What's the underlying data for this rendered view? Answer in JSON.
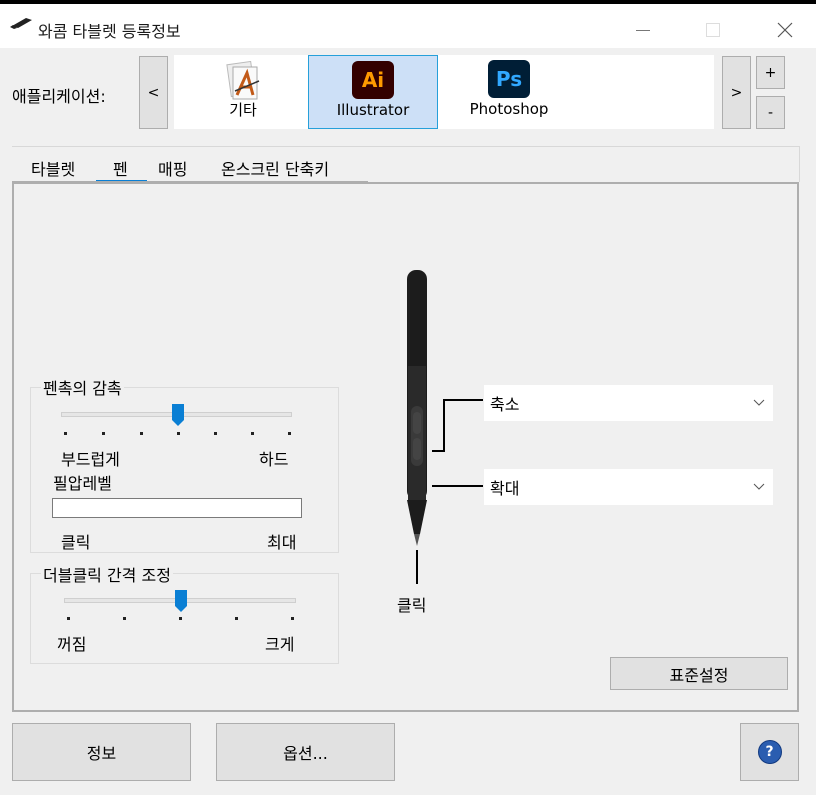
{
  "window": {
    "title": "와콤 타블렛 등록정보"
  },
  "app_bar": {
    "label": "애플리케이션:",
    "prev": "<",
    "next": ">",
    "add": "+",
    "remove": "-",
    "apps": [
      {
        "name": "기타",
        "icon": "other-apps-icon"
      },
      {
        "name": "Illustrator",
        "icon": "illustrator-icon",
        "icon_text": "Ai",
        "selected": true
      },
      {
        "name": "Photoshop",
        "icon": "photoshop-icon",
        "icon_text": "Ps"
      }
    ]
  },
  "tabs": [
    {
      "label": "타블렛"
    },
    {
      "label": "펜",
      "active": true
    },
    {
      "label": "매핑"
    },
    {
      "label": "온스크린 단축키"
    }
  ],
  "tip_feel": {
    "title": "펜촉의 감촉",
    "soft": "부드럽게",
    "firm": "하드",
    "level": 0.5,
    "pressure_label": "필압레벨",
    "click": "클릭",
    "max": "최대"
  },
  "double_click": {
    "title": "더블클릭 간격 조정",
    "off": "꺼짐",
    "large": "크게",
    "level": 0.5
  },
  "pen": {
    "upper_button": "축소",
    "lower_button": "확대",
    "tip": "클릭"
  },
  "buttons": {
    "default": "표준설정",
    "about": "정보",
    "options": "옵션...",
    "help": "?"
  },
  "colors": {
    "accent": "#0a7fd4",
    "ai_bg": "#330000",
    "ai_fg": "#ff9a00",
    "ps_bg": "#001e36",
    "ps_fg": "#31a8ff"
  }
}
